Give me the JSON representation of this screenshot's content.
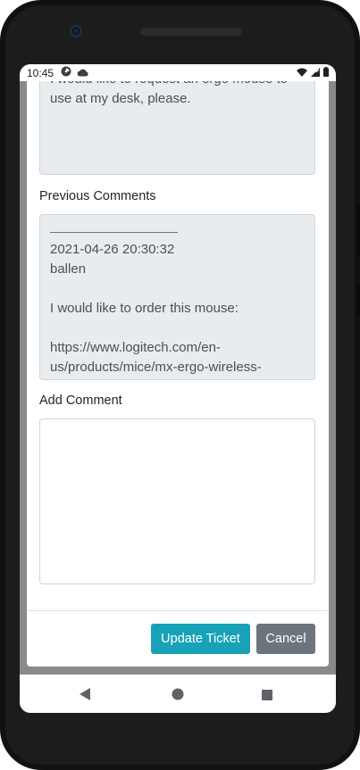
{
  "status_bar": {
    "time": "10:45"
  },
  "form": {
    "request_text": "I would like to request an ergo mouse to use at my desk, please.",
    "previous_comments_label": "Previous Comments",
    "previous_comments": {
      "timestamp": "2021-04-26 20:30:32",
      "author": "ballen",
      "body": "I would like to order this mouse:\n\nhttps://www.logitech.com/en-us/products/mice/mx-ergo-wireless-trackball-mouse.html"
    },
    "add_comment_label": "Add Comment",
    "add_comment_value": ""
  },
  "buttons": {
    "update": "Update Ticket",
    "cancel": "Cancel"
  },
  "colors": {
    "primary": "#17a2b8",
    "secondary": "#6c757d",
    "readonly_bg": "#e9ecef"
  }
}
